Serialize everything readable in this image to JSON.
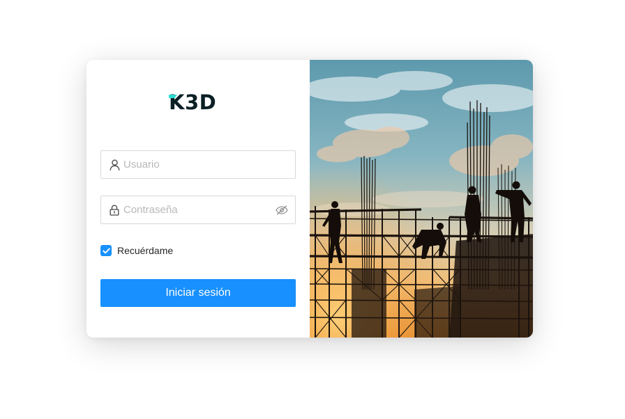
{
  "logo": {
    "text": "K3D"
  },
  "form": {
    "username": {
      "placeholder": "Usuario",
      "value": ""
    },
    "password": {
      "placeholder": "Contraseña",
      "value": ""
    },
    "remember": {
      "label": "Recuérdame",
      "checked": true
    },
    "submit_label": "Iniciar sesión"
  },
  "icons": {
    "username_prefix": "user-icon",
    "password_prefix": "lock-icon",
    "password_toggle": "eye-invisible-icon",
    "checkbox_mark": "check-icon"
  },
  "colors": {
    "primary": "#1890ff",
    "logo_text": "#0b1f24",
    "logo_accent": "#26e0d8",
    "border": "#d9d9d9",
    "placeholder": "#b8b8b8"
  },
  "illustration": {
    "subject": "construction-workers-silhouette-on-scaffolding"
  }
}
